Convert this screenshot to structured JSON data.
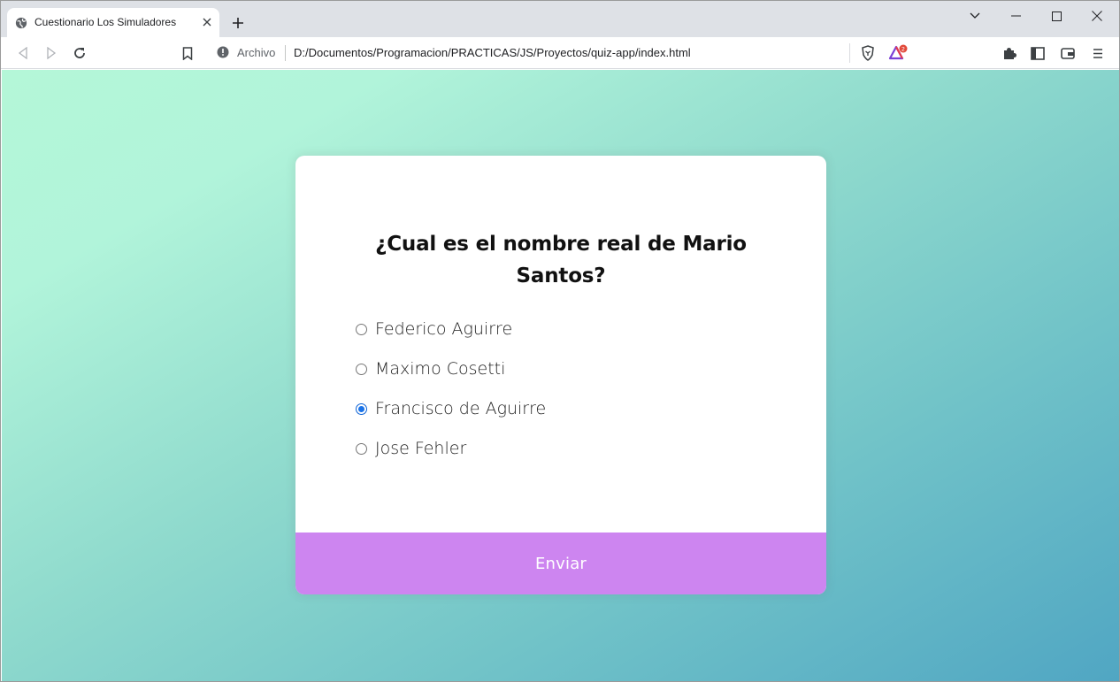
{
  "browser": {
    "tab": {
      "title": "Cuestionario Los Simuladores"
    },
    "address": {
      "scheme_label": "Archivo",
      "url": "D:/Documentos/Programacion/PRACTICAS/JS/Proyectos/quiz-app/index.html"
    },
    "brave_rewards_badge": "2"
  },
  "quiz": {
    "question": "¿Cual es el nombre real de Mario Santos?",
    "answers": [
      {
        "label": "Federico Aguirre",
        "checked": false
      },
      {
        "label": "Maximo Cosetti",
        "checked": false
      },
      {
        "label": "Francisco de Aguirre",
        "checked": true
      },
      {
        "label": "Jose Fehler",
        "checked": false
      }
    ],
    "submit_label": "Enviar"
  },
  "colors": {
    "submit_bg": "#cd85f0",
    "gradient_start": "#b4f7d8",
    "gradient_end": "#50a6c3",
    "radio_checked": "#1a73e8"
  }
}
